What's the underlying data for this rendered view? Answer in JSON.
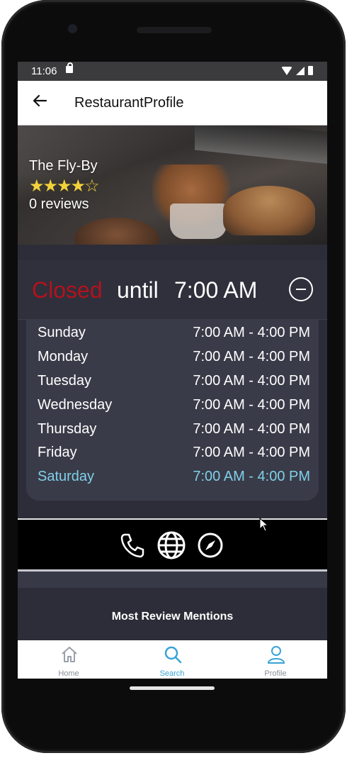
{
  "status_bar": {
    "time": "11:06"
  },
  "app_bar": {
    "title": "RestaurantProfile",
    "back_icon": "arrow-left-icon"
  },
  "restaurant": {
    "name": "The Fly-By",
    "rating": 4.5,
    "rating_max": 5,
    "stars_text": "★★★★☆",
    "reviews": "0 reviews"
  },
  "status": {
    "closed": "Closed",
    "until": "until",
    "time": "7:00 AM",
    "closed_color": "#b3121c"
  },
  "hours": [
    {
      "day": "Sunday",
      "time": "7:00 AM - 4:00 PM"
    },
    {
      "day": "Monday",
      "time": "7:00 AM - 4:00 PM"
    },
    {
      "day": "Tuesday",
      "time": "7:00 AM - 4:00 PM"
    },
    {
      "day": "Wednesday",
      "time": "7:00 AM - 4:00 PM"
    },
    {
      "day": "Thursday",
      "time": "7:00 AM - 4:00 PM"
    },
    {
      "day": "Friday",
      "time": "7:00 AM - 4:00 PM"
    },
    {
      "day": "Saturday",
      "time": "7:00 AM - 4:00 PM"
    }
  ],
  "today_color": "#7ed0ea",
  "actions": [
    "phone-icon",
    "globe-icon",
    "compass-icon"
  ],
  "mentions": {
    "title": "Most Review Mentions"
  },
  "bottom_nav": {
    "items": [
      {
        "label": "Home",
        "icon": "home-icon",
        "active": false
      },
      {
        "label": "Search",
        "icon": "search-icon",
        "active": true
      },
      {
        "label": "Profile",
        "icon": "profile-icon",
        "active": false
      }
    ],
    "active_color": "#3aa3d6",
    "inactive_color": "#8a8f99"
  }
}
